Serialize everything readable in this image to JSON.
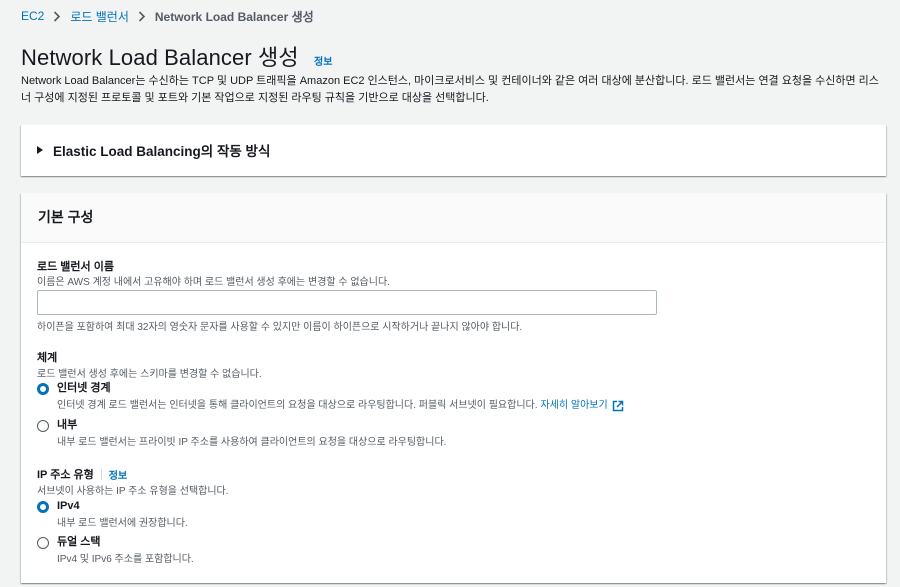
{
  "breadcrumb": {
    "items": [
      "EC2",
      "로드 밸런서"
    ],
    "current": "Network Load Balancer 생성"
  },
  "header": {
    "title": "Network Load Balancer 생성",
    "info_label": "정보",
    "description": "Network Load Balancer는 수신하는 TCP 및 UDP 트래픽을 Amazon EC2 인스턴스, 마이크로서비스 및 컨테이너와 같은 여러 대상에 분산합니다. 로드 밸런서는 연결 요청을 수신하면 리스너 구성에 지정된 프로토콜 및 포트와 기본 작업으로 지정된 라우팅 규칙을 기반으로 대상을 선택합니다."
  },
  "elb_panel": {
    "title": "Elastic Load Balancing의 작동 방식",
    "expanded": false
  },
  "basic_config": {
    "title": "기본 구성",
    "name_field": {
      "label": "로드 밸런서 이름",
      "description": "이름은 AWS 계정 내에서 고유해야 하며 로드 밸런서 생성 후에는 변경할 수 없습니다.",
      "value": "",
      "constraint": "하이픈을 포함하여 최대 32자의 영숫자 문자를 사용할 수 있지만 이름이 하이픈으로 시작하거나 끝나지 않아야 합니다."
    },
    "scheme": {
      "label": "체계",
      "description": "로드 밸런서 생성 후에는 스키마를 변경할 수 없습니다.",
      "options": [
        {
          "label": "인터넷 경계",
          "description": "인터넷 경계 로드 밸런서는 인터넷을 통해 클라이언트의 요청을 대상으로 라우팅합니다. 퍼블릭 서브넷이 필요합니다.",
          "link": "자세히 알아보기",
          "checked": true
        },
        {
          "label": "내부",
          "description": "내부 로드 밸런서는 프라이빗 IP 주소를 사용하여 클라이언트의 요청을 대상으로 라우팅합니다.",
          "checked": false
        }
      ]
    },
    "ip_type": {
      "label": "IP 주소 유형",
      "info_label": "정보",
      "description": "서브넷이 사용하는 IP 주소 유형을 선택합니다.",
      "options": [
        {
          "label": "IPv4",
          "description": "내부 로드 밸런서에 권장합니다.",
          "checked": true
        },
        {
          "label": "듀얼 스택",
          "description": "IPv4 및 IPv6 주소를 포함합니다.",
          "checked": false
        }
      ]
    }
  },
  "colors": {
    "link": "#0073bb",
    "background": "#f2f3f3",
    "text": "#16191f",
    "muted": "#545b64"
  }
}
